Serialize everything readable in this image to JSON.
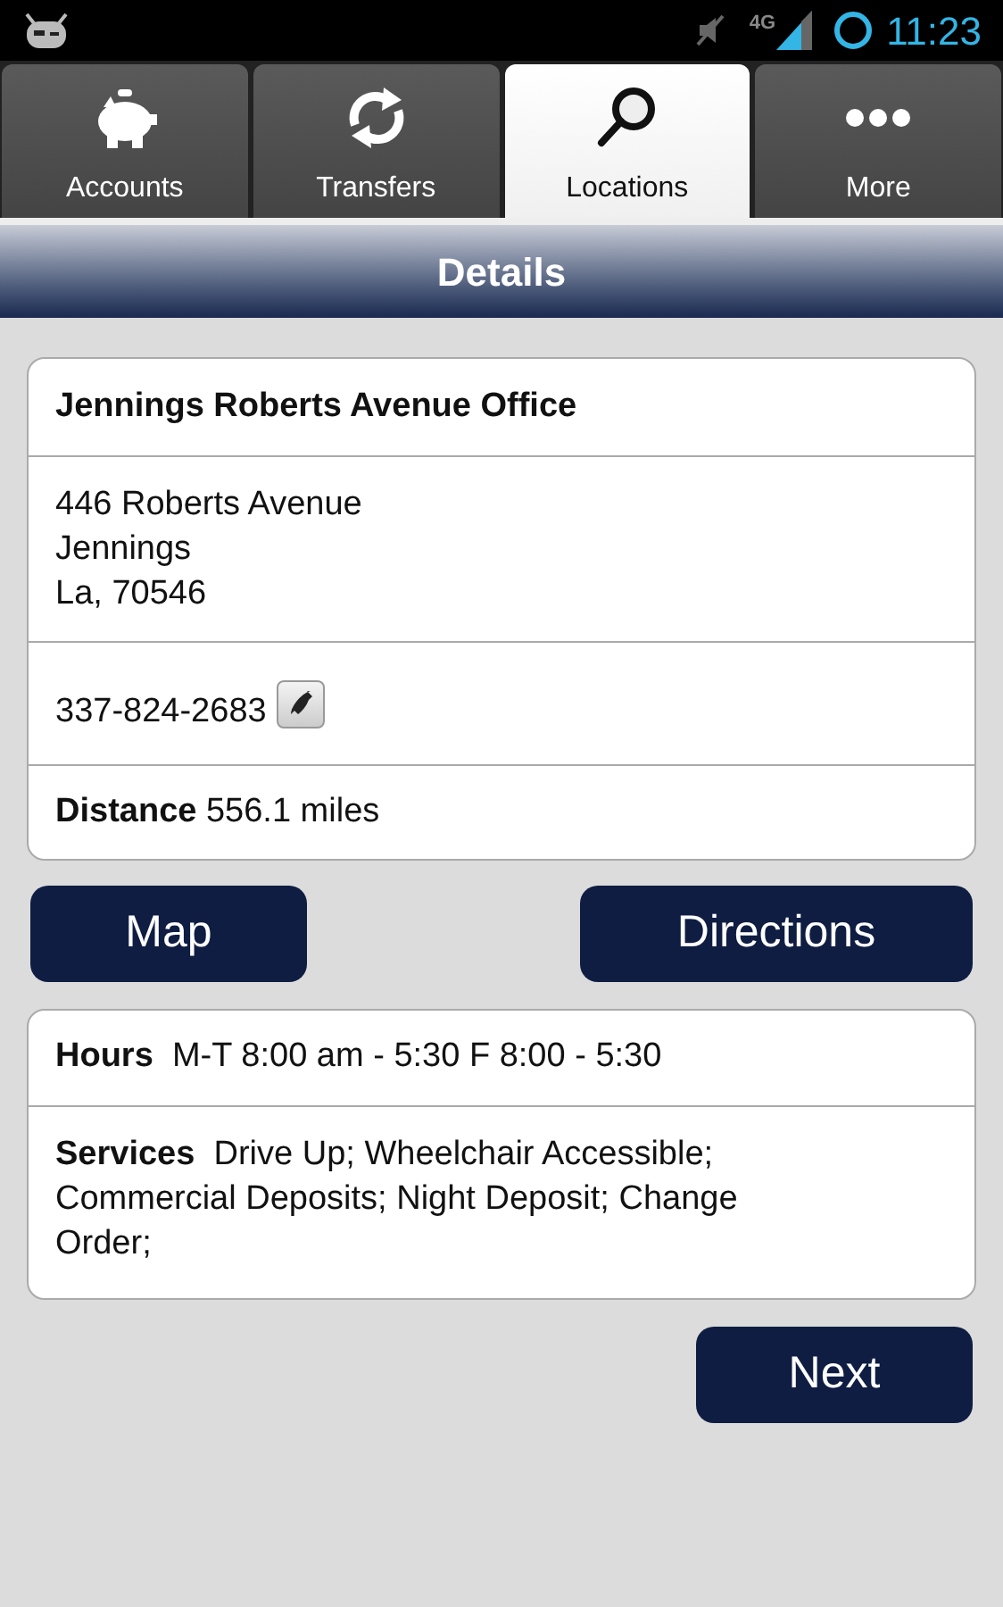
{
  "status_bar": {
    "network": "4G",
    "time": "11:23"
  },
  "tabs": [
    {
      "label": "Accounts",
      "selected": false
    },
    {
      "label": "Transfers",
      "selected": false
    },
    {
      "label": "Locations",
      "selected": true
    },
    {
      "label": "More",
      "selected": false
    }
  ],
  "header": {
    "title": "Details"
  },
  "office": {
    "name": "Jennings Roberts Avenue Office",
    "address": [
      "446 Roberts Avenue",
      "Jennings",
      "La, 70546"
    ],
    "phone": "337-824-2683",
    "distance": "**Distance** 556.1 miles"
  },
  "actions": [
    "Map",
    "Directions"
  ],
  "info": {
    "hours": "**Hours**  M-T 8:00 am - 5:30 F 8:00 - 5:30",
    "services": "**Services**  Drive Up; Wheelchair Accessible; Commercial Deposits; Night Deposit; Change Order;"
  },
  "next_button": "Next"
}
